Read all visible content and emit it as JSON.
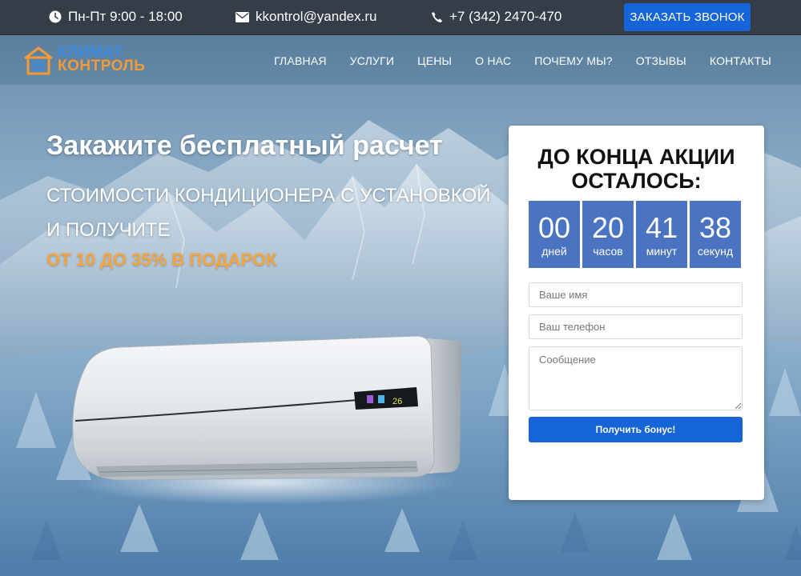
{
  "topbar": {
    "hours": "Пн-Пт 9:00 - 18:00",
    "email": "kkontrol@yandex.ru",
    "phone": "+7 (342) 2470-470",
    "call_button": "ЗАКАЗАТЬ ЗВОНОК",
    "icons": [
      "clock-icon",
      "envelope-icon",
      "phone-icon"
    ]
  },
  "logo": {
    "line1": "КЛИМАТ",
    "line2": "КОНТРОЛЬ"
  },
  "nav": [
    "ГЛАВНАЯ",
    "УСЛУГИ",
    "ЦЕНЫ",
    "О НАС",
    "ПОЧЕМУ МЫ?",
    "ОТЗЫВЫ",
    "КОНТАКТЫ"
  ],
  "hero": {
    "title": "Закажите бесплатный расчет",
    "sub_line1": "СТОИМОСТИ КОНДИЦИОНЕРА С УСТАНОВКОЙ",
    "sub_line2": "И ПОЛУЧИТЕ",
    "accent": "ОТ 10 ДО 35% В ПОДАРОК"
  },
  "ac_display": {
    "temp": "26"
  },
  "promo": {
    "title_line1": "ДО КОНЦА АКЦИИ",
    "title_line2": "ОСТАЛОСЬ:",
    "countdown": [
      {
        "value": "00",
        "unit": "дней"
      },
      {
        "value": "20",
        "unit": "часов"
      },
      {
        "value": "41",
        "unit": "минут"
      },
      {
        "value": "38",
        "unit": "секунд"
      }
    ],
    "name_placeholder": "Ваше имя",
    "phone_placeholder": "Ваш телефон",
    "message_placeholder": "Сообщение",
    "submit_label": "Получить бонус!"
  },
  "colors": {
    "topbar": "#343d48",
    "accent_blue": "#1565d8",
    "timer_blue": "#4a74c1",
    "accent_orange": "#f5a43e"
  }
}
